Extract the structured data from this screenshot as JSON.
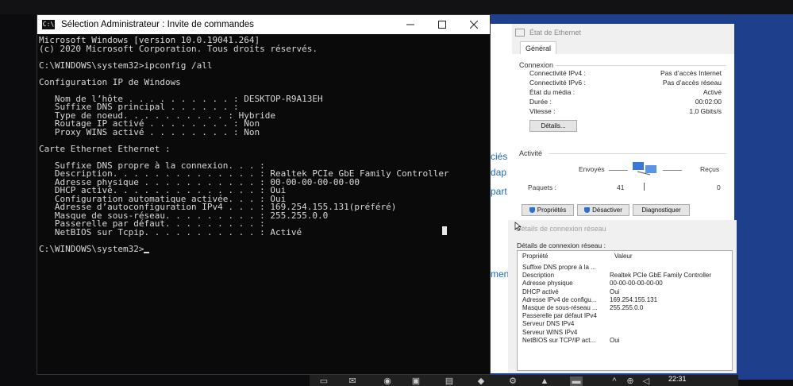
{
  "cmd": {
    "title": "Sélection Administrateur : Invite de commandes",
    "icon": "C:\\",
    "lines": [
      "Microsoft Windows [version 10.0.19041.264]",
      "(c) 2020 Microsoft Corporation. Tous droits réservés.",
      "",
      "C:\\WINDOWS\\system32>ipconfig /all",
      "",
      "Configuration IP de Windows",
      "",
      "   Nom de l’hôte . . . . . . . . . . : DESKTOP-R9A13EH",
      "   Suffixe DNS principal . . . . . . :",
      "   Type de noeud. . . . . . . . . . : Hybride",
      "   Routage IP activé . . . . . . . . : Non",
      "   Proxy WINS activé . . . . . . . . : Non",
      "",
      "Carte Ethernet Ethernet :",
      "",
      "   Suffixe DNS propre à la connexion. . . :",
      "   Description. . . . . . . . . . . . . . : Realtek PCIe GbE Family Controller",
      "   Adresse physique . . . . . . . . . . . : 00-00-00-00-00-00",
      "   DHCP activé. . . . . . . . . . . . . . : Oui",
      "   Configuration automatique activée. . . : Oui",
      "   Adresse d’autoconfiguration IPv4 . . . : 169.254.155.131(préféré)",
      "   Masque de sous-réseau. . . . . . . . . : 255.255.0.0",
      "   Passerelle par défaut. . . . . . . . . :",
      "   NetBIOS sur Tcpip. . . . . . . . . . . : Activé",
      "",
      "C:\\WINDOWS\\system32>"
    ]
  },
  "background_fragments": [
    "ciés",
    "dap",
    "part",
    "menta"
  ],
  "ethernet_status": {
    "title": "État de Ethernet",
    "tab": "Général",
    "connexion_group": "Connexion",
    "rows": [
      {
        "label": "Connectivité IPv4 :",
        "value": "Pas d’accès Internet"
      },
      {
        "label": "Connectivité IPv6 :",
        "value": "Pas d’accès réseau"
      },
      {
        "label": "État du média :",
        "value": "Activé"
      },
      {
        "label": "Durée :",
        "value": "00:02:00"
      },
      {
        "label": "Vitesse :",
        "value": "1,0 Gbits/s"
      }
    ],
    "details_button": "Détails...",
    "activite_group": "Activité",
    "envoyes": "Envoyés",
    "recus": "Reçus",
    "paquets_label": "Paquets :",
    "paquets_sent": "41",
    "paquets_received": "0",
    "buttons": {
      "proprietes": "Propriétés",
      "desactiver": "Désactiver",
      "diagnostiquer": "Diagnostiquer"
    }
  },
  "details_window": {
    "title": "Détails de connexion réseau",
    "label": "Détails de connexion réseau :",
    "col_property": "Propriété",
    "col_value": "Valeur",
    "rows": [
      {
        "prop": "Suffixe DNS propre à la ...",
        "value": ""
      },
      {
        "prop": "Description",
        "value": "Realtek PCIe GbE Family Controller"
      },
      {
        "prop": "Adresse physique",
        "value": "00-00-00-00-00-00"
      },
      {
        "prop": "DHCP activé",
        "value": "Oui"
      },
      {
        "prop": "Adresse IPv4 de configu...",
        "value": "169.254.155.131"
      },
      {
        "prop": "Masque de sous-réseau ...",
        "value": "255.255.0.0"
      },
      {
        "prop": "Passerelle par défaut IPv4",
        "value": ""
      },
      {
        "prop": "Serveur DNS IPv4",
        "value": ""
      },
      {
        "prop": "Serveur WINS IPv4",
        "value": ""
      },
      {
        "prop": "NetBIOS sur TCP/IP act...",
        "value": "Oui"
      }
    ]
  },
  "taskbar": {
    "clock": "22:31"
  }
}
